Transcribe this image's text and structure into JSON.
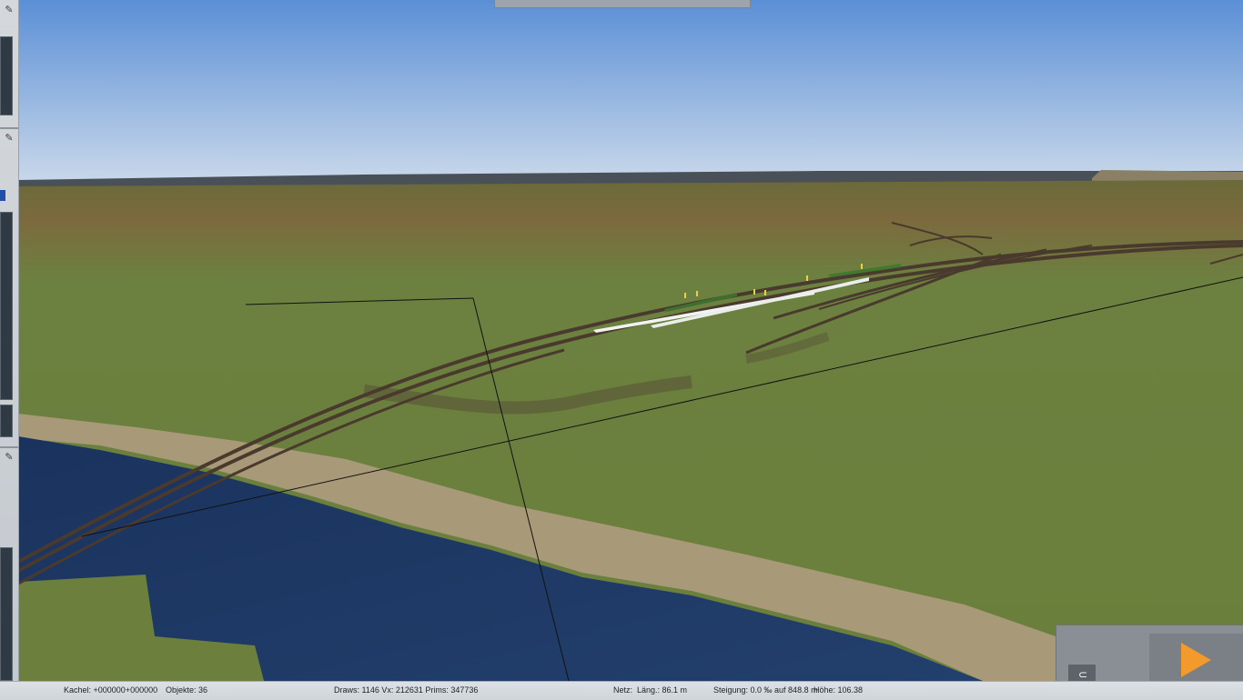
{
  "status_bar": {
    "tile": "Kachel: +000000+000000",
    "objects": "Objekte: 36",
    "render_stats": "Draws: 1146 Vx: 212631 Prims: 347736",
    "network_prefix": "Netz:",
    "length": "Läng.: 86.1 m",
    "gradient": "Steigung: 0.0 ‰ auf 848.8 m",
    "height": "Höhe: 106.38"
  },
  "icons": {
    "pin": "pin-icon",
    "lock": "padlock-open-icon",
    "play": "play-icon"
  },
  "colors": {
    "sky_top": "#5b8fd6",
    "sky_horizon": "#c9d8ea",
    "grass": "#6f813e",
    "water": "#1e3a66",
    "track": "#4a3a2e",
    "play_accent": "#f29a2c"
  }
}
